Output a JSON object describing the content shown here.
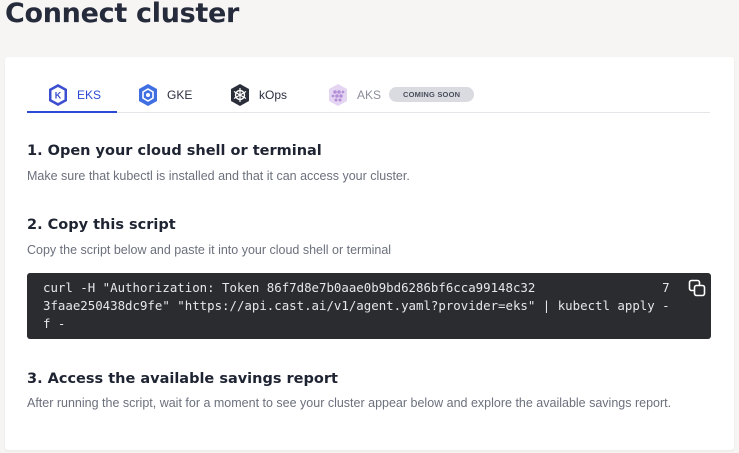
{
  "page": {
    "title": "Connect cluster"
  },
  "tabs": [
    {
      "label": "EKS",
      "icon": "eks-icon",
      "active": true
    },
    {
      "label": "GKE",
      "icon": "gke-icon"
    },
    {
      "label": "kOps",
      "icon": "kops-icon"
    },
    {
      "label": "AKS",
      "icon": "aks-icon",
      "badge": "COMING SOON",
      "disabled": true
    }
  ],
  "steps": [
    {
      "title": "1. Open your cloud shell or terminal",
      "description": "Make sure that kubectl is installed and that it can access your cluster."
    },
    {
      "title": "2. Copy this script",
      "description": "Copy the script below and paste it into your cloud shell or terminal"
    },
    {
      "title": "3. Access the available savings report",
      "description": "After running the script, wait for a moment to see your cluster appear below and explore the available savings report."
    }
  ],
  "script": {
    "command": "curl -H \"Authorization: Token 86f7d8e7b0aae0b9bd6286bf6cca99148c32                 73faae250438dc9fe\" \"https://api.cast.ai/v1/agent.yaml?provider=eks\" | kubectl apply -f -"
  },
  "colors": {
    "accent": "#2c4ad6",
    "code_bg": "#2a2c30",
    "page_bg": "#f6f5f3"
  }
}
